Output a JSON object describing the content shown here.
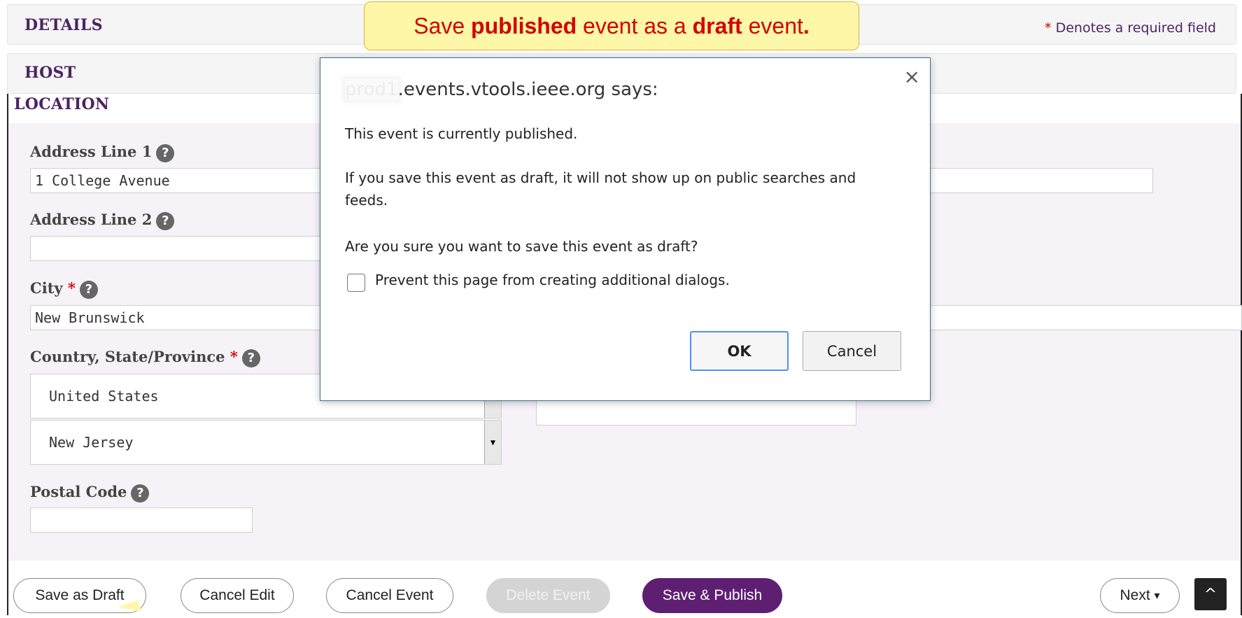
{
  "sections": {
    "details": "DETAILS",
    "host": "HOST",
    "location": "LOCATION"
  },
  "required_note": {
    "star": "*",
    "text": "Denotes a required field"
  },
  "callout": {
    "part1": "Save ",
    "bold1": "published",
    "part2": " event as a ",
    "bold2": "draft",
    "part3": " event",
    "bold3": "."
  },
  "form": {
    "address1": {
      "label": "Address Line 1",
      "value": "1 College Avenue"
    },
    "address2": {
      "label": "Address Line 2",
      "value": ""
    },
    "city": {
      "label": "City",
      "star": "*",
      "value": "New Brunswick"
    },
    "country_state": {
      "label": "Country, State/Province",
      "star": "*",
      "country": "United States",
      "state": "New Jersey"
    },
    "postal": {
      "label": "Postal Code",
      "value": ""
    },
    "help_glyph": "?"
  },
  "buttons": {
    "save_draft": "Save as Draft",
    "cancel_edit": "Cancel Edit",
    "cancel_event": "Cancel Event",
    "delete_event": "Delete Event",
    "save_publish": "Save & Publish",
    "next": "Next",
    "next_caret": "▾",
    "to_top": "^"
  },
  "dialog": {
    "title_blurred": "prod1",
    "title_rest": ".events.vtools.ieee.org says:",
    "close": "×",
    "line1": "This event is currently published.",
    "line2": "If you save this event as draft, it will not show up on public searches and feeds.",
    "line3": "Are you sure you want to save this event as draft?",
    "checkbox_label": "Prevent this page from creating additional dialogs.",
    "ok": "OK",
    "cancel": "Cancel"
  }
}
